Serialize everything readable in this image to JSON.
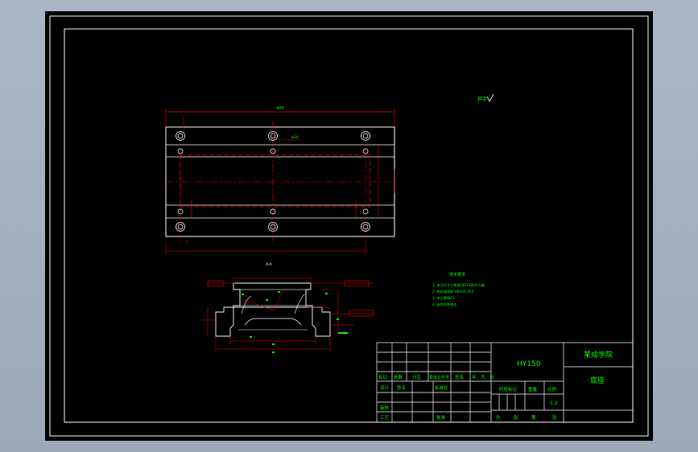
{
  "drawing": {
    "roughness_label": "其余",
    "dim_top": "400",
    "dim_mid": "φ20",
    "tech_title": "技术要求",
    "tech_notes": [
      "1. 未注尺寸公差按GB/T1804-m级",
      "2. 热处理调质 HB220-250",
      "3. 未注倒角C1",
      "4. 去除毛刺锐边"
    ],
    "section_mark": "A-A"
  },
  "title_block": {
    "drawing_no": "HY150",
    "company": "某成学院",
    "part_name": "底座",
    "headers": [
      "标记",
      "处数",
      "分区",
      "更改文件号",
      "签名",
      "年、月、日"
    ],
    "row_design": [
      "设计",
      "签名",
      "标准化"
    ],
    "row_check": "审核",
    "row_process": "工艺",
    "row_approve": "批准",
    "stage_label": "阶段标记",
    "weight_label": "重量",
    "scale_label": "比例",
    "scale_value": "1:2",
    "sheet_text": [
      "共",
      "张",
      "第",
      "张"
    ]
  },
  "colors": {
    "sheet_bg": "#000000",
    "border": "#ffffff",
    "outline": "#ffffff",
    "dimension": "#ff0000",
    "text": "#00ff00",
    "hidden": "#ff0000"
  }
}
